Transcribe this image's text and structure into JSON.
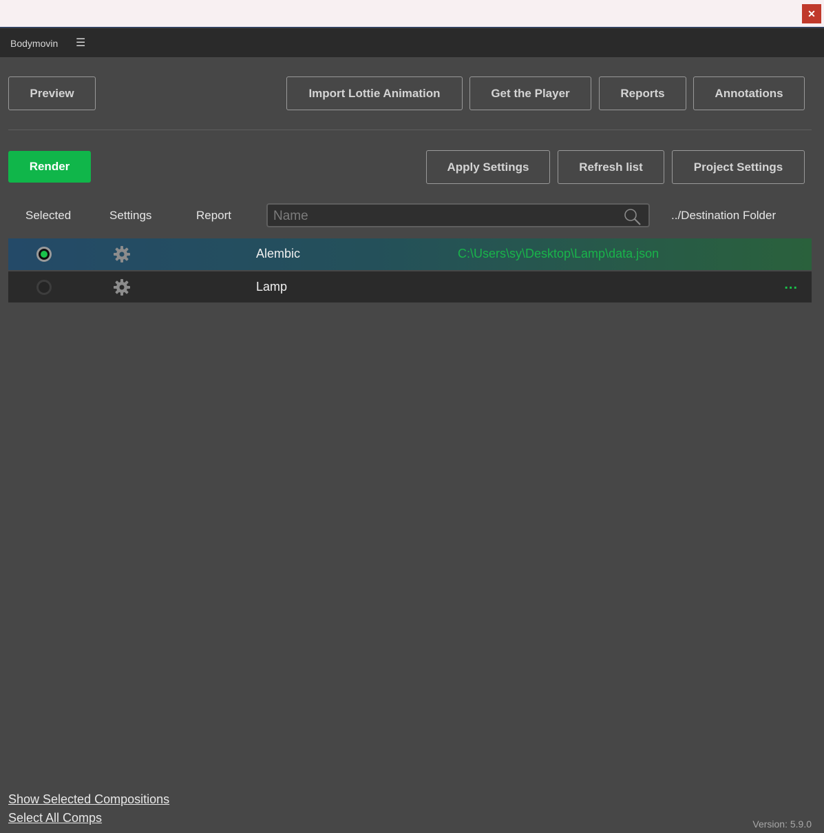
{
  "window": {
    "close_glyph": "✕"
  },
  "panel": {
    "title": "Bodymovin",
    "menu_glyph": "☰"
  },
  "toolbar": {
    "preview": "Preview",
    "import": "Import Lottie Animation",
    "player": "Get the Player",
    "reports": "Reports",
    "annotations": "Annotations"
  },
  "actions": {
    "render": "Render",
    "apply_settings": "Apply Settings",
    "refresh_list": "Refresh list",
    "project_settings": "Project Settings"
  },
  "columns": {
    "selected": "Selected",
    "settings": "Settings",
    "report": "Report",
    "destination": "../Destination Folder"
  },
  "search": {
    "placeholder": "Name"
  },
  "compositions": [
    {
      "name": "Alembic",
      "selected": true,
      "destination": "C:\\Users\\sy\\Desktop\\Lamp\\data.json"
    },
    {
      "name": "Lamp",
      "selected": false,
      "more": "..."
    }
  ],
  "footer": {
    "show_selected": "Show Selected Compositions",
    "select_all": "Select All Comps",
    "version": "Version: 5.9.0"
  },
  "colors": {
    "accent_green": "#10b64a",
    "background": "#474747"
  }
}
